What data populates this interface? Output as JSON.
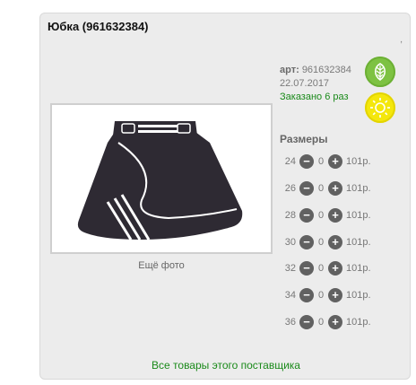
{
  "product": {
    "title": "Юбка (961632384)",
    "dot": ",",
    "art_label": "арт:",
    "art_number": "961632384",
    "date": "22.07.2017",
    "ordered": "Заказано 6 раз"
  },
  "photo": {
    "more_label": "Ещё фото"
  },
  "sizes": {
    "heading": "Размеры",
    "rows": [
      {
        "size": "24",
        "qty": "0",
        "price": "101р."
      },
      {
        "size": "26",
        "qty": "0",
        "price": "101р."
      },
      {
        "size": "28",
        "qty": "0",
        "price": "101р."
      },
      {
        "size": "30",
        "qty": "0",
        "price": "101р."
      },
      {
        "size": "32",
        "qty": "0",
        "price": "101р."
      },
      {
        "size": "34",
        "qty": "0",
        "price": "101р."
      },
      {
        "size": "36",
        "qty": "0",
        "price": "101р."
      }
    ],
    "minus_symbol": "−",
    "plus_symbol": "+"
  },
  "footer": {
    "supplier_link": "Все товары этого поставщика"
  },
  "icons": {
    "eco": "leaf-icon",
    "season": "sun-icon",
    "decrement": "minus-icon",
    "increment": "plus-icon"
  },
  "colors": {
    "accent_green": "#1a8a1a",
    "leaf_badge": "#7dc242",
    "sun_badge": "#f4e70c",
    "button_dark": "#616161"
  }
}
